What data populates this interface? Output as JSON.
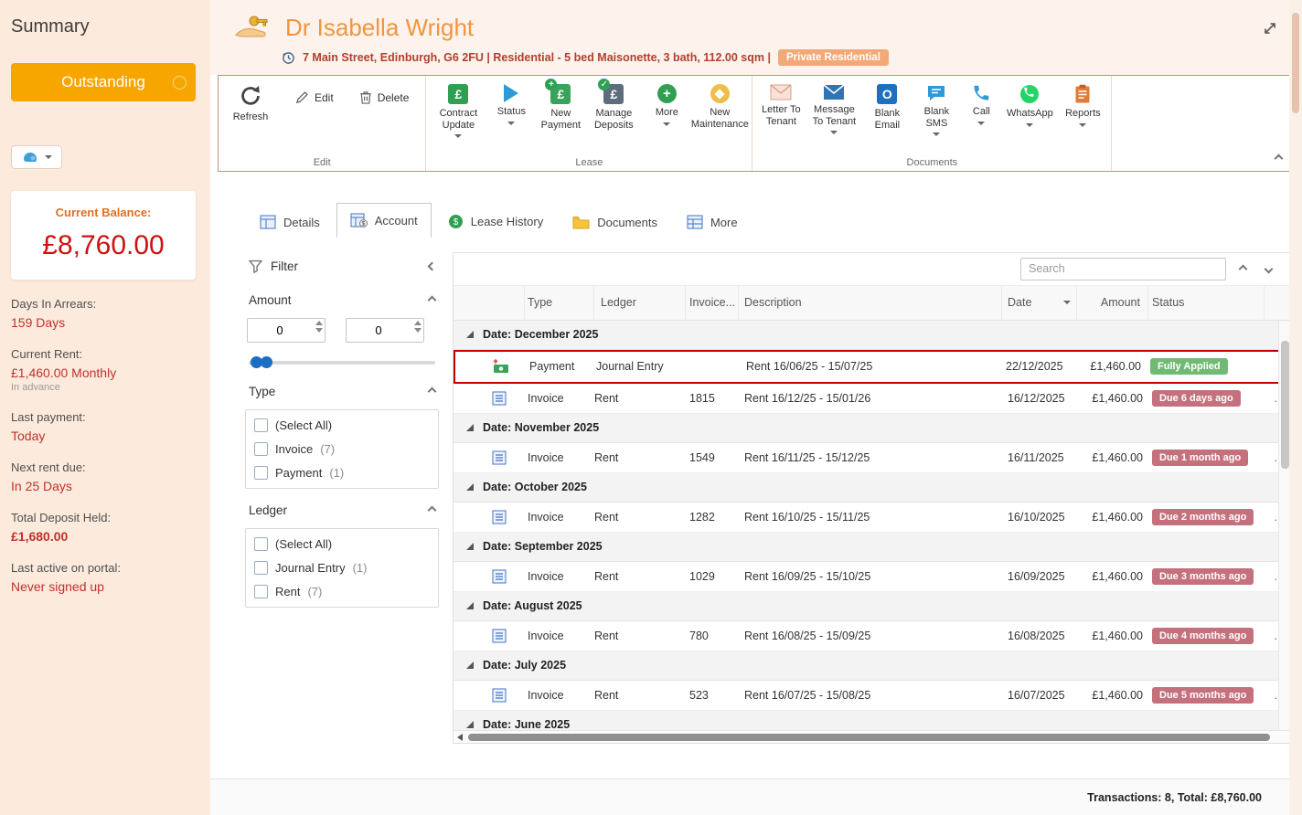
{
  "sidebar": {
    "title": "Summary",
    "outstanding_button": "Outstanding",
    "balance_card": {
      "label": "Current Balance:",
      "value": "£8,760.00"
    },
    "stats": [
      {
        "label": "Days In Arrears:",
        "value": "159 Days"
      },
      {
        "label": "Current Rent:",
        "value": "£1,460.00 Monthly",
        "note": "In advance"
      },
      {
        "label": "Last payment:",
        "value": "Today"
      },
      {
        "label": "Next rent due:",
        "value": "In 25 Days"
      },
      {
        "label": "Total Deposit Held:",
        "value": "£1,680.00"
      },
      {
        "label": "Last active on portal:",
        "value": "Never signed up"
      }
    ]
  },
  "header": {
    "title": "Dr Isabella Wright",
    "address": "7 Main Street, Edinburgh, G6 2FU | Residential - 5 bed Maisonette, 3 bath, 112.00 sqm |",
    "badge": "Private Residential"
  },
  "ribbon": {
    "edit_group": {
      "label": "Edit",
      "refresh": "Refresh",
      "edit": "Edit",
      "delete": "Delete"
    },
    "lease_group": {
      "label": "Lease",
      "buttons": [
        {
          "label": "Contract Update",
          "dropdown": true
        },
        {
          "label": "Status",
          "dropdown": true
        },
        {
          "label": "New Payment",
          "dropdown": false
        },
        {
          "label": "Manage Deposits",
          "dropdown": false
        },
        {
          "label": "More",
          "dropdown": true
        },
        {
          "label": "New Maintenance",
          "dropdown": false
        }
      ]
    },
    "documents_group": {
      "label": "Documents",
      "buttons": [
        {
          "label": "Letter To Tenant",
          "dropdown": false
        },
        {
          "label": "Message To Tenant",
          "dropdown": true
        },
        {
          "label": "Blank Email",
          "dropdown": false
        },
        {
          "label": "Blank SMS",
          "dropdown": true
        },
        {
          "label": "Call",
          "dropdown": true
        },
        {
          "label": "WhatsApp",
          "dropdown": true
        },
        {
          "label": "Reports",
          "dropdown": true
        }
      ]
    }
  },
  "tabs": [
    {
      "label": "Details"
    },
    {
      "label": "Account"
    },
    {
      "label": "Lease History"
    },
    {
      "label": "Documents"
    },
    {
      "label": "More"
    }
  ],
  "filter": {
    "title": "Filter",
    "amount": {
      "label": "Amount",
      "min": "0",
      "max": "0"
    },
    "type": {
      "label": "Type",
      "options": [
        {
          "label": "(Select All)",
          "count": ""
        },
        {
          "label": "Invoice",
          "count": "(7)"
        },
        {
          "label": "Payment",
          "count": "(1)"
        }
      ]
    },
    "ledger": {
      "label": "Ledger",
      "options": [
        {
          "label": "(Select All)",
          "count": ""
        },
        {
          "label": "Journal Entry",
          "count": "(1)"
        },
        {
          "label": "Rent",
          "count": "(7)"
        }
      ]
    }
  },
  "table": {
    "search_placeholder": "Search",
    "columns": {
      "type": "Type",
      "ledger": "Ledger",
      "invoice": "Invoice...",
      "description": "Description",
      "date": "Date",
      "amount": "Amount",
      "status": "Status"
    },
    "groups": [
      {
        "label": "Date: December 2025",
        "rows": [
          {
            "type": "Payment",
            "ledger": "Journal Entry",
            "invoice": "",
            "description": "Rent 16/06/25 - 15/07/25",
            "date": "22/12/2025",
            "amount": "£1,460.00",
            "status": "Fully Applied",
            "more": ""
          },
          {
            "type": "Invoice",
            "ledger": "Rent",
            "invoice": "1815",
            "description": "Rent 16/12/25 - 15/01/26",
            "date": "16/12/2025",
            "amount": "£1,460.00",
            "status": "Due 6 days ago",
            "more": ".."
          }
        ]
      },
      {
        "label": "Date: November 2025",
        "rows": [
          {
            "type": "Invoice",
            "ledger": "Rent",
            "invoice": "1549",
            "description": "Rent 16/11/25 - 15/12/25",
            "date": "16/11/2025",
            "amount": "£1,460.00",
            "status": "Due 1 month ago",
            "more": ".."
          }
        ]
      },
      {
        "label": "Date: October 2025",
        "rows": [
          {
            "type": "Invoice",
            "ledger": "Rent",
            "invoice": "1282",
            "description": "Rent 16/10/25 - 15/11/25",
            "date": "16/10/2025",
            "amount": "£1,460.00",
            "status": "Due 2 months ago",
            "more": ".."
          }
        ]
      },
      {
        "label": "Date: September 2025",
        "rows": [
          {
            "type": "Invoice",
            "ledger": "Rent",
            "invoice": "1029",
            "description": "Rent 16/09/25 - 15/10/25",
            "date": "16/09/2025",
            "amount": "£1,460.00",
            "status": "Due 3 months ago",
            "more": ".."
          }
        ]
      },
      {
        "label": "Date: August 2025",
        "rows": [
          {
            "type": "Invoice",
            "ledger": "Rent",
            "invoice": "780",
            "description": "Rent 16/08/25 - 15/09/25",
            "date": "16/08/2025",
            "amount": "£1,460.00",
            "status": "Due 4 months ago",
            "more": ".."
          }
        ]
      },
      {
        "label": "Date: July 2025",
        "rows": [
          {
            "type": "Invoice",
            "ledger": "Rent",
            "invoice": "523",
            "description": "Rent 16/07/25 - 15/08/25",
            "date": "16/07/2025",
            "amount": "£1,460.00",
            "status": "Due 5 months ago",
            "more": ".."
          }
        ]
      },
      {
        "label": "Date: June 2025",
        "rows": []
      }
    ]
  },
  "footer": {
    "summary": "Transactions: 8, Total: £8,760.00"
  }
}
